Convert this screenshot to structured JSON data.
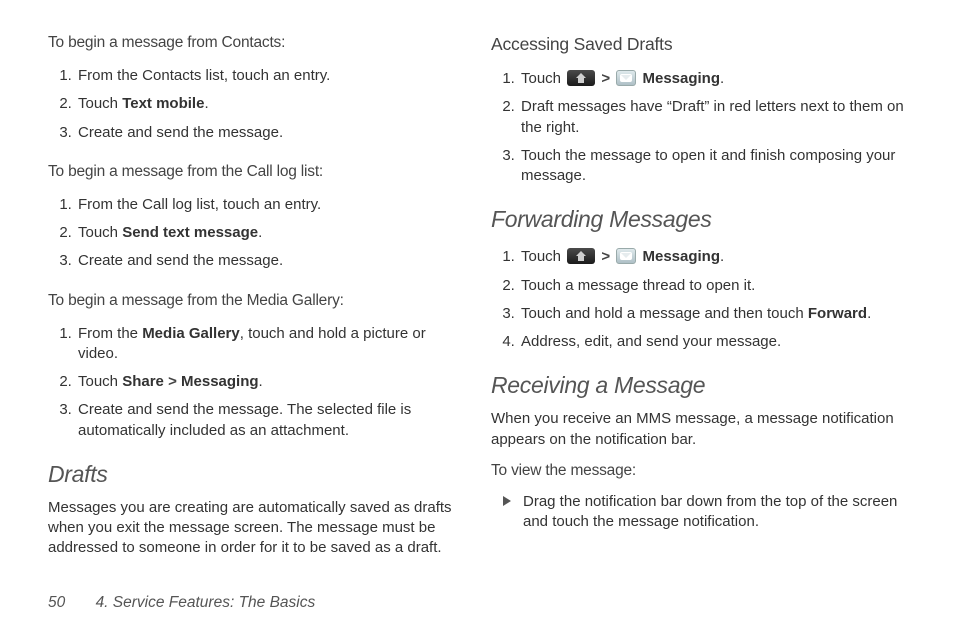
{
  "left": {
    "intro1": "To begin a message from Contacts:",
    "steps1": {
      "s1": "From the Contacts list, touch an entry.",
      "s2a": "Touch ",
      "s2b": "Text mobile",
      "s2c": ".",
      "s3": "Create and send the message."
    },
    "intro2": "To begin a message from the Call log list:",
    "steps2": {
      "s1": "From the Call log list, touch an entry.",
      "s2a": "Touch ",
      "s2b": "Send text message",
      "s2c": ".",
      "s3": "Create and send the message."
    },
    "intro3": "To begin a message from the Media Gallery:",
    "steps3": {
      "s1a": "From the ",
      "s1b": "Media Gallery",
      "s1c": ", touch and hold a picture or video.",
      "s2a": "Touch ",
      "s2b": "Share",
      "s2c": " > ",
      "s2d": "Messaging",
      "s2e": ".",
      "s3": "Create and send the message. The selected file is automatically included as an attachment."
    },
    "drafts_h": "Drafts",
    "drafts_p": "Messages you are creating are automatically saved as drafts when you exit the message screen. The message must be addressed to someone in order for it to be saved as a draft."
  },
  "right": {
    "asd_h": "Accessing Saved Drafts",
    "asd": {
      "s1a": "Touch ",
      "s1gt": " > ",
      "s1b": "Messaging",
      "s1c": ".",
      "s2": "Draft messages have “Draft” in red letters next to them on the right.",
      "s3": "Touch the message to open it and finish composing your message."
    },
    "fm_h": "Forwarding Messages",
    "fm": {
      "s1a": "Touch ",
      "s1gt": " > ",
      "s1b": "Messaging",
      "s1c": ".",
      "s2": "Touch a message thread to open it.",
      "s3a": "Touch and hold a message and then touch ",
      "s3b": "Forward",
      "s3c": ".",
      "s4": "Address, edit, and send your message."
    },
    "rm_h": "Receiving a Message",
    "rm_p": "When you receive an MMS message, a message notification appears on the notification bar.",
    "rm_intro": "To view the message:",
    "rm_b1": "Drag the notification bar down from the top of the screen and touch the message notification."
  },
  "footer": {
    "page": "50",
    "chapter": "4. Service Features: The Basics"
  }
}
